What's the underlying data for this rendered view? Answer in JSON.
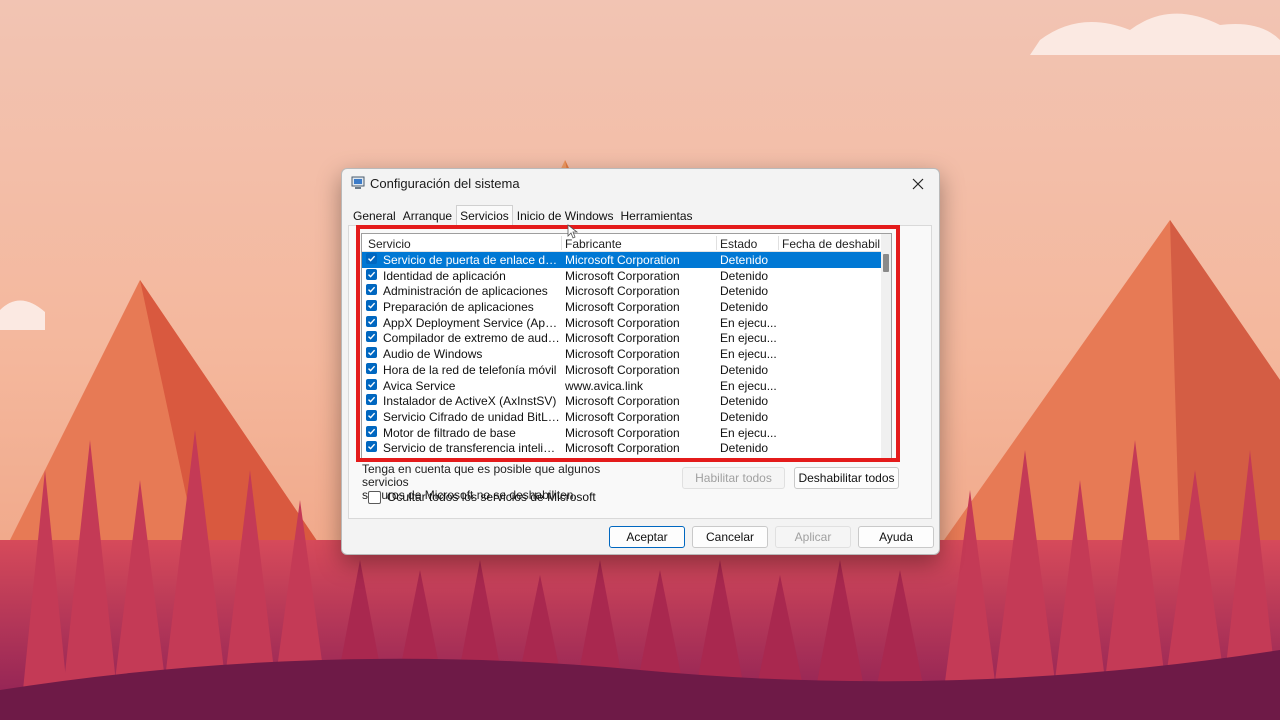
{
  "window": {
    "title": "Configuración del sistema",
    "close_icon": "close-icon",
    "app_icon": "system-config-icon"
  },
  "tabs": [
    {
      "label": "General",
      "active": false
    },
    {
      "label": "Arranque",
      "active": false
    },
    {
      "label": "Servicios",
      "active": true
    },
    {
      "label": "Inicio de Windows",
      "active": false
    },
    {
      "label": "Herramientas",
      "active": false
    }
  ],
  "list": {
    "columns": [
      "Servicio",
      "Fabricante",
      "Estado",
      "Fecha de deshabil..."
    ],
    "rows": [
      {
        "service": "Servicio de puerta de enlace de ni...",
        "vendor": "Microsoft Corporation",
        "state": "Detenido",
        "date": "",
        "checked": true,
        "selected": true
      },
      {
        "service": "Identidad de aplicación",
        "vendor": "Microsoft Corporation",
        "state": "Detenido",
        "date": "",
        "checked": true
      },
      {
        "service": "Administración de aplicaciones",
        "vendor": "Microsoft Corporation",
        "state": "Detenido",
        "date": "",
        "checked": true
      },
      {
        "service": "Preparación de aplicaciones",
        "vendor": "Microsoft Corporation",
        "state": "Detenido",
        "date": "",
        "checked": true
      },
      {
        "service": "AppX Deployment Service (AppXS...",
        "vendor": "Microsoft Corporation",
        "state": "En ejecu...",
        "date": "",
        "checked": true
      },
      {
        "service": "Compilador de extremo de audio ...",
        "vendor": "Microsoft Corporation",
        "state": "En ejecu...",
        "date": "",
        "checked": true
      },
      {
        "service": "Audio de Windows",
        "vendor": "Microsoft Corporation",
        "state": "En ejecu...",
        "date": "",
        "checked": true
      },
      {
        "service": "Hora de la red de telefonía móvil",
        "vendor": "Microsoft Corporation",
        "state": "Detenido",
        "date": "",
        "checked": true
      },
      {
        "service": "Avica Service",
        "vendor": "www.avica.link",
        "state": "En ejecu...",
        "date": "",
        "checked": true
      },
      {
        "service": "Instalador de ActiveX (AxInstSV)",
        "vendor": "Microsoft Corporation",
        "state": "Detenido",
        "date": "",
        "checked": true
      },
      {
        "service": "Servicio Cifrado de unidad BitLocker",
        "vendor": "Microsoft Corporation",
        "state": "Detenido",
        "date": "",
        "checked": true
      },
      {
        "service": "Motor de filtrado de base",
        "vendor": "Microsoft Corporation",
        "state": "En ejecu...",
        "date": "",
        "checked": true
      },
      {
        "service": "Servicio de transferencia inteligent...",
        "vendor": "Microsoft Corporation",
        "state": "Detenido",
        "date": "",
        "checked": true
      }
    ]
  },
  "note": {
    "line1": "Tenga en cuenta que es posible que algunos servicios",
    "line2": "seguros de Microsoft no se deshabiliten."
  },
  "buttons": {
    "enable_all": "Habilitar todos",
    "disable_all": "Deshabilitar todos",
    "ok": "Aceptar",
    "cancel": "Cancelar",
    "apply": "Aplicar",
    "help": "Ayuda"
  },
  "hide_ms": {
    "label": "Ocultar todos los servicios de Microsoft",
    "checked": false
  },
  "colors": {
    "selection": "#0078d4",
    "highlight_box": "#e41b1b",
    "checkbox": "#0067c0"
  }
}
